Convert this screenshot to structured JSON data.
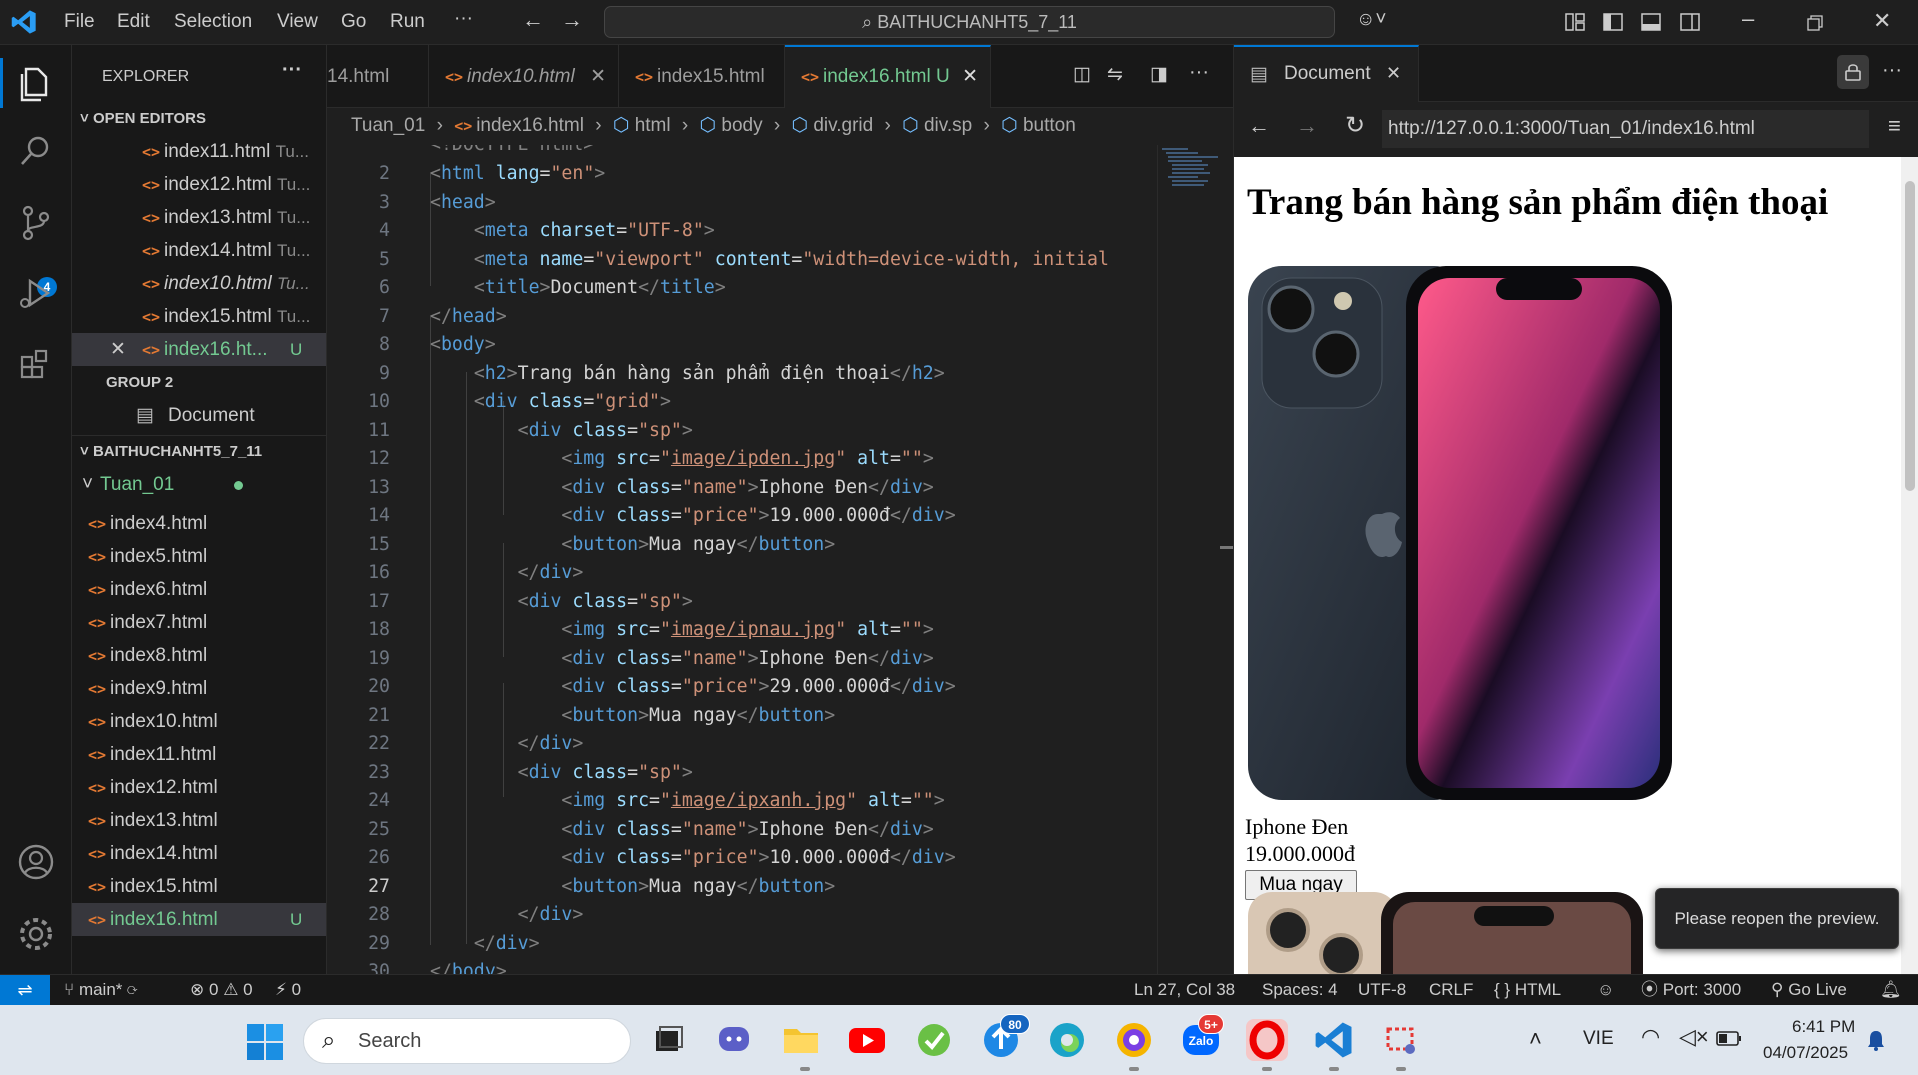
{
  "menu": [
    "File",
    "Edit",
    "Selection",
    "View",
    "Go",
    "Run"
  ],
  "command_center": "BAITHUCHANHT5_7_11",
  "activity": {
    "scm_badge": "4"
  },
  "sidebar": {
    "explorer_title": "EXPLORER",
    "open_editors_title": "OPEN EDITORS",
    "open_editors": [
      {
        "name": "index11.html",
        "hint": "Tu..."
      },
      {
        "name": "index12.html",
        "hint": "Tu..."
      },
      {
        "name": "index13.html",
        "hint": "Tu..."
      },
      {
        "name": "index14.html",
        "hint": "Tu..."
      },
      {
        "name": "index10.html",
        "hint": "Tu..."
      },
      {
        "name": "index15.html",
        "hint": "Tu..."
      }
    ],
    "active_editor": {
      "name": "index16.ht...",
      "status": "U"
    },
    "group2_title": "GROUP 2",
    "group2_item": "Document",
    "project_title": "BAITHUCHANHT5_7_11",
    "folder": "Tuan_01",
    "files": [
      "index4.html",
      "index5.html",
      "index6.html",
      "index7.html",
      "index8.html",
      "index9.html",
      "index10.html",
      "index11.html",
      "index12.html",
      "index13.html",
      "index14.html",
      "index15.html"
    ],
    "active_file": {
      "name": "index16.html",
      "status": "U"
    }
  },
  "editor": {
    "tabs": [
      {
        "name": "14.html"
      },
      {
        "name": "index10.html"
      },
      {
        "name": "index15.html"
      },
      {
        "name": "index16.html",
        "status": "U"
      }
    ],
    "breadcrumb": [
      "Tuan_01",
      "index16.html",
      "html",
      "body",
      "div.grid",
      "div.sp",
      "button"
    ],
    "cursor_line": "27"
  },
  "browser": {
    "tab_title": "Document",
    "url": "http://127.0.0.1:3000/Tuan_01/index16.html",
    "page": {
      "heading": "Trang bán hàng sản phẩm điện thoại",
      "product_name": "Iphone Đen",
      "product_price": "19.000.000đ",
      "buy_button": "Mua ngay"
    },
    "toast": "Please reopen the preview."
  },
  "status": {
    "branch": "main*",
    "errors": "0",
    "warnings": "0",
    "ports_count": "0",
    "position": "Ln 27, Col 38",
    "spaces": "Spaces: 4",
    "encoding": "UTF-8",
    "eol": "CRLF",
    "language": "HTML",
    "port": "Port: 3000",
    "golive": "Go Live"
  },
  "taskbar": {
    "search_placeholder": "Search",
    "store_badge": "80",
    "zalo_badge": "5+",
    "zalo_label": "Zalo",
    "lang": "VIE",
    "time": "6:41 PM",
    "date": "04/07/2025"
  },
  "colors": {
    "accent": "#0078d4",
    "modified": "#73c991",
    "html_icon": "#e37933"
  }
}
